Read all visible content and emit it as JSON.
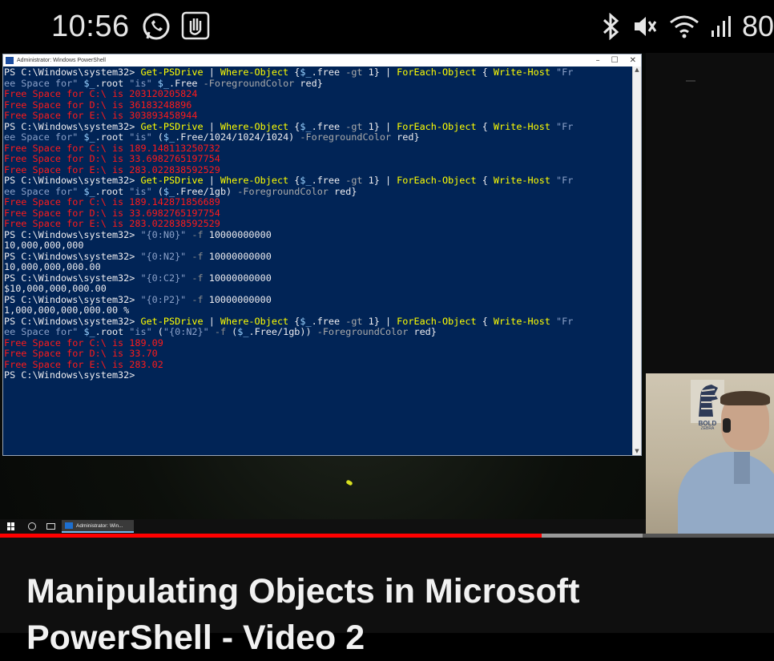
{
  "status_bar": {
    "time": "10:56",
    "battery": "80"
  },
  "powershell": {
    "title": "Administrator: Windows PowerShell",
    "controls": [
      "–",
      "☐",
      "✕"
    ],
    "lines": [
      [
        [
          "PS C:\\Windows\\system32> ",
          "w"
        ],
        [
          "Get-PSDrive",
          "y"
        ],
        [
          " | ",
          "w"
        ],
        [
          "Where-Object",
          "y"
        ],
        [
          " {",
          "w"
        ],
        [
          "$_",
          "v"
        ],
        [
          ".free ",
          "w"
        ],
        [
          "-gt",
          "g"
        ],
        [
          " 1} | ",
          "w"
        ],
        [
          "ForEach-Object",
          "y"
        ],
        [
          " { ",
          "w"
        ],
        [
          "Write-Host",
          "y"
        ],
        [
          " \"Fr",
          "b"
        ]
      ],
      [
        [
          "ee Space for\" ",
          "b"
        ],
        [
          "$_",
          "v"
        ],
        [
          ".root ",
          "w"
        ],
        [
          "\"is\" ",
          "b"
        ],
        [
          "$_",
          "v"
        ],
        [
          ".Free ",
          "w"
        ],
        [
          "-ForegroundColor",
          "g"
        ],
        [
          " red}",
          "w"
        ]
      ],
      [
        [
          "Free Space for C:\\ is 203120205824",
          "r"
        ]
      ],
      [
        [
          "Free Space for D:\\ is 36183248896",
          "r"
        ]
      ],
      [
        [
          "Free Space for E:\\ is 303893458944",
          "r"
        ]
      ],
      [
        [
          "PS C:\\Windows\\system32> ",
          "w"
        ],
        [
          "Get-PSDrive",
          "y"
        ],
        [
          " | ",
          "w"
        ],
        [
          "Where-Object",
          "y"
        ],
        [
          " {",
          "w"
        ],
        [
          "$_",
          "v"
        ],
        [
          ".free ",
          "w"
        ],
        [
          "-gt",
          "g"
        ],
        [
          " 1} | ",
          "w"
        ],
        [
          "ForEach-Object",
          "y"
        ],
        [
          " { ",
          "w"
        ],
        [
          "Write-Host",
          "y"
        ],
        [
          " \"Fr",
          "b"
        ]
      ],
      [
        [
          "ee Space for\" ",
          "b"
        ],
        [
          "$_",
          "v"
        ],
        [
          ".root ",
          "w"
        ],
        [
          "\"is\" ",
          "b"
        ],
        [
          "(",
          "w"
        ],
        [
          "$_",
          "v"
        ],
        [
          ".Free/1024/1024/1024) ",
          "w"
        ],
        [
          "-ForegroundColor",
          "g"
        ],
        [
          " red}",
          "w"
        ]
      ],
      [
        [
          "Free Space for C:\\ is 189.148113250732",
          "r"
        ]
      ],
      [
        [
          "Free Space for D:\\ is 33.6982765197754",
          "r"
        ]
      ],
      [
        [
          "Free Space for E:\\ is 283.022838592529",
          "r"
        ]
      ],
      [
        [
          "PS C:\\Windows\\system32> ",
          "w"
        ],
        [
          "Get-PSDrive",
          "y"
        ],
        [
          " | ",
          "w"
        ],
        [
          "Where-Object",
          "y"
        ],
        [
          " {",
          "w"
        ],
        [
          "$_",
          "v"
        ],
        [
          ".free ",
          "w"
        ],
        [
          "-gt",
          "g"
        ],
        [
          " 1} | ",
          "w"
        ],
        [
          "ForEach-Object",
          "y"
        ],
        [
          " { ",
          "w"
        ],
        [
          "Write-Host",
          "y"
        ],
        [
          " \"Fr",
          "b"
        ]
      ],
      [
        [
          "ee Space for\" ",
          "b"
        ],
        [
          "$_",
          "v"
        ],
        [
          ".root ",
          "w"
        ],
        [
          "\"is\" ",
          "b"
        ],
        [
          "(",
          "w"
        ],
        [
          "$_",
          "v"
        ],
        [
          ".Free/1gb) ",
          "w"
        ],
        [
          "-ForegroundColor",
          "g"
        ],
        [
          " red}",
          "w"
        ]
      ],
      [
        [
          "Free Space for C:\\ is 189.142871856689",
          "r"
        ]
      ],
      [
        [
          "Free Space for D:\\ is 33.6982765197754",
          "r"
        ]
      ],
      [
        [
          "Free Space for E:\\ is 283.022838592529",
          "r"
        ]
      ],
      [
        [
          "PS C:\\Windows\\system32> ",
          "w"
        ],
        [
          "\"{0:N0}\"",
          "b"
        ],
        [
          " -f ",
          "gt"
        ],
        [
          "10000000000",
          "w"
        ]
      ],
      [
        [
          "10,000,000,000",
          "w"
        ]
      ],
      [
        [
          "PS C:\\Windows\\system32> ",
          "w"
        ],
        [
          "\"{0:N2}\"",
          "b"
        ],
        [
          " -f ",
          "gt"
        ],
        [
          "10000000000",
          "w"
        ]
      ],
      [
        [
          "10,000,000,000.00",
          "w"
        ]
      ],
      [
        [
          "PS C:\\Windows\\system32> ",
          "w"
        ],
        [
          "\"{0:C2}\"",
          "b"
        ],
        [
          " -f ",
          "gt"
        ],
        [
          "10000000000",
          "w"
        ]
      ],
      [
        [
          "$10,000,000,000.00",
          "w"
        ]
      ],
      [
        [
          "PS C:\\Windows\\system32> ",
          "w"
        ],
        [
          "\"{0:P2}\"",
          "b"
        ],
        [
          " -f ",
          "gt"
        ],
        [
          "10000000000",
          "w"
        ]
      ],
      [
        [
          "1,000,000,000,000.00 %",
          "w"
        ]
      ],
      [
        [
          "PS C:\\Windows\\system32> ",
          "w"
        ],
        [
          "Get-PSDrive",
          "y"
        ],
        [
          " | ",
          "w"
        ],
        [
          "Where-Object",
          "y"
        ],
        [
          " {",
          "w"
        ],
        [
          "$_",
          "v"
        ],
        [
          ".free ",
          "w"
        ],
        [
          "-gt",
          "g"
        ],
        [
          " 1} | ",
          "w"
        ],
        [
          "ForEach-Object",
          "y"
        ],
        [
          " { ",
          "w"
        ],
        [
          "Write-Host",
          "y"
        ],
        [
          " \"Fr",
          "b"
        ]
      ],
      [
        [
          "ee Space for\" ",
          "b"
        ],
        [
          "$_",
          "v"
        ],
        [
          ".root ",
          "w"
        ],
        [
          "\"is\" ",
          "b"
        ],
        [
          "(",
          "w"
        ],
        [
          "\"{0:N2}\"",
          "b"
        ],
        [
          " -f ",
          "gt"
        ],
        [
          "(",
          "w"
        ],
        [
          "$_",
          "v"
        ],
        [
          ".Free/1gb)) ",
          "w"
        ],
        [
          "-ForegroundColor",
          "g"
        ],
        [
          " red}",
          "w"
        ]
      ],
      [
        [
          "Free Space for C:\\ is 189.09",
          "r"
        ]
      ],
      [
        [
          "Free Space for D:\\ is 33.70",
          "r"
        ]
      ],
      [
        [
          "Free Space for E:\\ is 283.02",
          "r"
        ]
      ],
      [
        [
          "PS C:\\Windows\\system32>",
          "w"
        ]
      ]
    ]
  },
  "taskbar": {
    "app_label": "Administrator: Win..."
  },
  "webcam": {
    "logo_text": "BOLD",
    "logo_sub": "ZEBRA"
  },
  "player": {
    "progress_fraction": 0.7,
    "buffer_fraction": 0.83
  },
  "video": {
    "title": "Manipulating Objects in Microsoft PowerShell - Video 2"
  },
  "colors": {
    "console_bg": "#012456",
    "progress": "#ff0000"
  }
}
